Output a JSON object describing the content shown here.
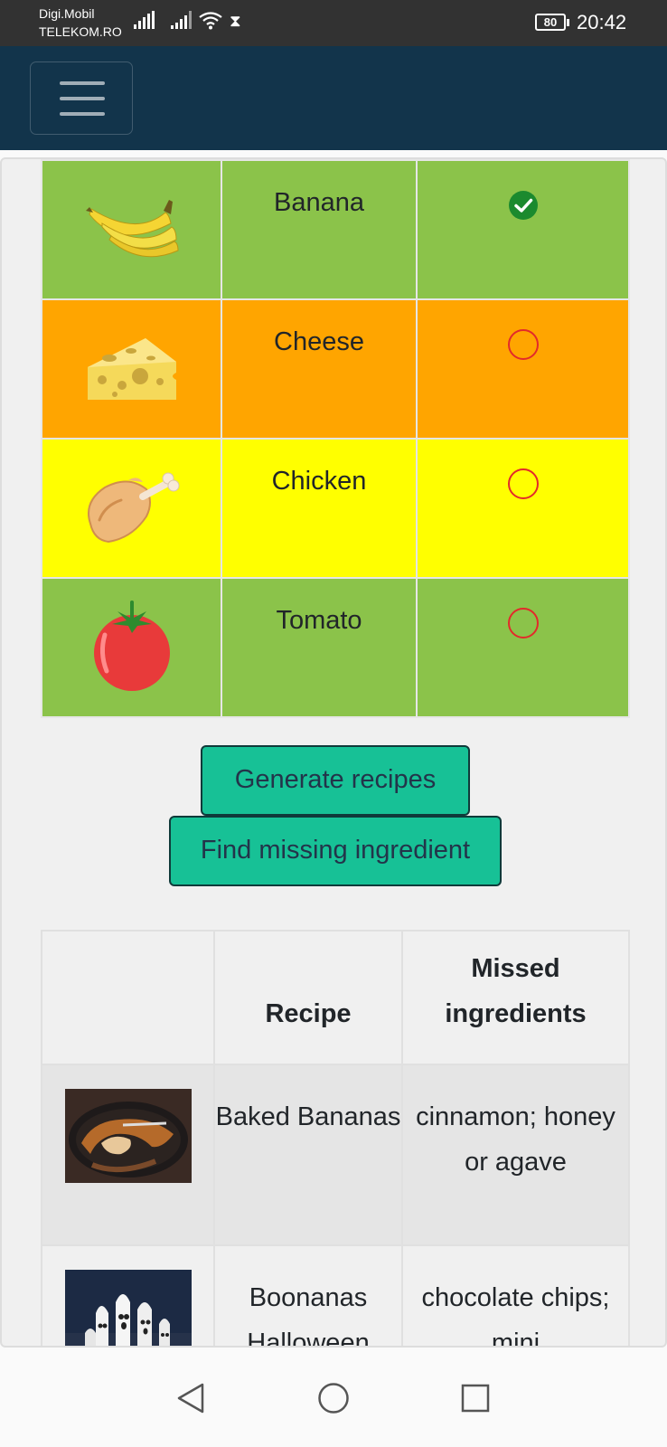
{
  "status_bar": {
    "carrier_line1": "Digi.Mobil",
    "carrier_line2": "TELEKOM.RO",
    "battery": "80",
    "time": "20:42"
  },
  "navbar": {
    "toggler_icon": "hamburger-menu-icon"
  },
  "ingredients": [
    {
      "name": "Banana",
      "icon": "banana-icon",
      "row_color": "#8bc34a",
      "selected": true
    },
    {
      "name": "Cheese",
      "icon": "cheese-icon",
      "row_color": "#ffa500",
      "selected": false
    },
    {
      "name": "Chicken",
      "icon": "chicken-leg-icon",
      "row_color": "#ffff00",
      "selected": false
    },
    {
      "name": "Tomato",
      "icon": "tomato-icon",
      "row_color": "#8bc34a",
      "selected": false
    }
  ],
  "buttons": {
    "generate": "Generate recipes",
    "find_missing": "Find missing ingredient"
  },
  "recipes_table": {
    "header_image": "",
    "header_recipe": "Recipe",
    "header_missed": "Missed ingredients",
    "rows": [
      {
        "name": "Baked Bananas",
        "missed": "cinnamon; honey or agave"
      },
      {
        "name": "Boonanas Halloween",
        "missed": "chocolate chips; mini"
      }
    ]
  },
  "colors": {
    "navbar": "#12344b",
    "button": "#17c196",
    "check": "#1b8a2e",
    "unselected": "#e32a2a"
  }
}
